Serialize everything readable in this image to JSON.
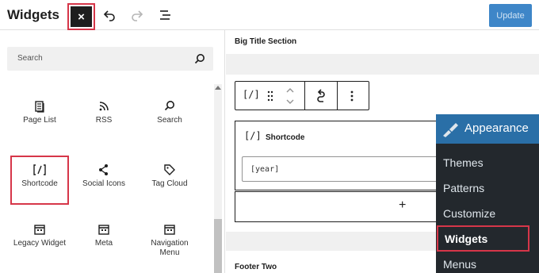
{
  "header": {
    "title": "Widgets",
    "close_glyph": "×",
    "update_label": "Update"
  },
  "inserter": {
    "search_placeholder": "Search",
    "blocks": [
      {
        "label": "Page List",
        "icon": "page-list-icon"
      },
      {
        "label": "RSS",
        "icon": "rss-icon"
      },
      {
        "label": "Search",
        "icon": "search-icon"
      },
      {
        "label": "Shortcode",
        "icon": "shortcode-icon",
        "highlighted": true
      },
      {
        "label": "Social Icons",
        "icon": "share-icon"
      },
      {
        "label": "Tag Cloud",
        "icon": "tag-icon"
      },
      {
        "label": "Legacy Widget",
        "icon": "calendar-icon"
      },
      {
        "label": "Meta",
        "icon": "calendar-icon"
      },
      {
        "label": "Navigation Menu",
        "label_line1": "Navigation",
        "label_line2": "Menu",
        "icon": "calendar-icon"
      }
    ]
  },
  "editor": {
    "section_top": "Big Title Section",
    "section_bottom": "Footer Two",
    "shortcode_icon": "[/]",
    "shortcode_title": "Shortcode",
    "shortcode_value": "[year]",
    "appender_glyph": "+"
  },
  "admin_menu": {
    "header": "Appearance",
    "items": [
      "Themes",
      "Patterns",
      "Customize",
      "Widgets",
      "Menus"
    ],
    "active": "Widgets"
  },
  "colors": {
    "accent": "#3e86c8",
    "highlight": "#d63649",
    "admin_bg": "#23282d",
    "admin_active": "#2a6fa7"
  }
}
